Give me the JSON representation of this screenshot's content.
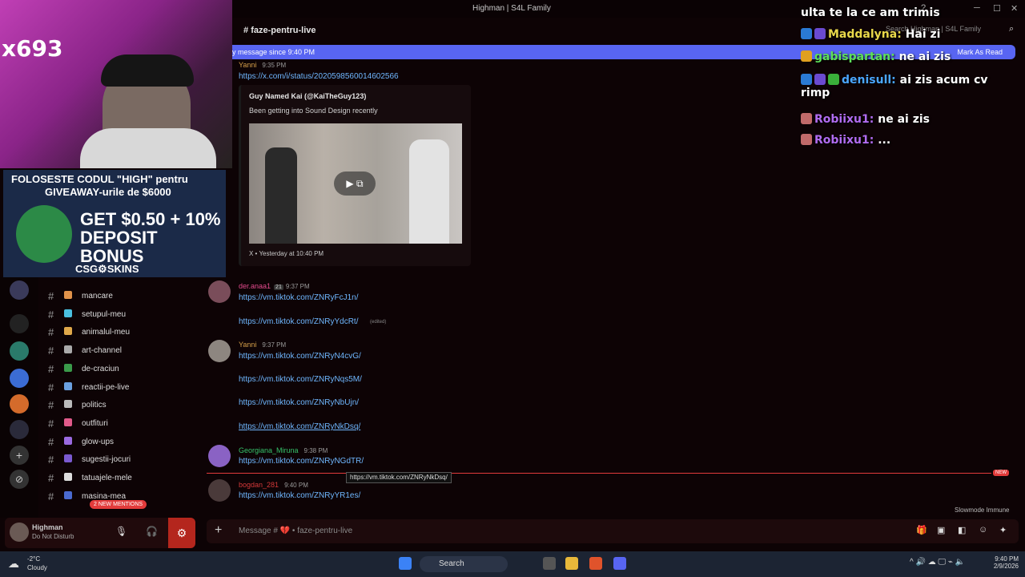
{
  "window": {
    "title": "Highman | S4L Family"
  },
  "channel": {
    "name": "faze-pentru-live",
    "search_placeholder": "Search Highman | S4L Family"
  },
  "banner": {
    "text": "y message since 9:40 PM",
    "mark_read": "Mark As Read"
  },
  "messages": [
    {
      "author": "Yanni",
      "time": "9:35 PM",
      "lines": [
        "https://x.com/i/status/2020598560014602566"
      ]
    },
    {
      "author": "der.anaa1",
      "badge": "21",
      "time": "9:37 PM",
      "lines": [
        "https://vm.tiktok.com/ZNRyFcJ1n/",
        "https://vm.tiktok.com/ZNRyYdcRt/"
      ],
      "edited": "(edited)"
    },
    {
      "author": "Yanni",
      "time": "9:37 PM",
      "lines": [
        "https://vm.tiktok.com/ZNRyN4cvG/",
        "https://vm.tiktok.com/ZNRyNqs5M/",
        "https://vm.tiktok.com/ZNRyNbUjn/",
        "https://vm.tiktok.com/ZNRyNkDsq/"
      ]
    },
    {
      "author": "Georgiana_Miruna",
      "time": "9:38 PM",
      "lines": [
        "https://vm.tiktok.com/ZNRyNGdTR/"
      ]
    },
    {
      "author": "bogdan_281",
      "time": "9:40 PM",
      "lines": [
        "https://vm.tiktok.com/ZNRyYR1es/"
      ]
    }
  ],
  "embed": {
    "author": "Guy Named Kai (@KaiTheGuy123)",
    "description": "Been getting into Sound Design recently",
    "footer": "X • Yesterday at 10:40 PM"
  },
  "tooltip": "https://vm.tiktok.com/ZNRyNkDsq/",
  "new_badge": "NEW",
  "slowmode": "Slowmode Immune",
  "composer": {
    "placeholder": "Message # 💔 • faze-pentru-live"
  },
  "webcam": {
    "count": "x693"
  },
  "ad": {
    "line1": "FOLOSESTE CODUL \"HIGH\" pentru",
    "line2": "GIVEAWAY-urile de $6000",
    "big1": "GET $0.50 + 10%",
    "big2": "DEPOSIT BONUS",
    "brand": "CSG⚙SKINS"
  },
  "channels": [
    "mancare",
    "setupul-meu",
    "animalul-meu",
    "art-channel",
    "de-craciun",
    "reactii-pe-live",
    "politics",
    "outfituri",
    "glow-ups",
    "sugestii-jocuri",
    "tatuajele-mele",
    "masina-mea"
  ],
  "mentions": "2 NEW MENTIONS",
  "user": {
    "name": "Highman",
    "status": "Do Not Disturb"
  },
  "chat_overlay": [
    {
      "user": "",
      "text": "ulta te la ce am trimis",
      "color": "#ffffff"
    },
    {
      "user": "Maddalyna:",
      "text": "Hai zi",
      "color": "#e8d84a"
    },
    {
      "user": "gabispartan:",
      "text": "ne ai zis",
      "color": "#5ee05a"
    },
    {
      "user": "denisull:",
      "text": "ai zis acum cv rimp",
      "color": "#4aa6ff"
    },
    {
      "user": "Robiixu1:",
      "text": "ne ai zis",
      "color": "#b06cf0"
    },
    {
      "user": "Robiixu1:",
      "text": "...",
      "color": "#b06cf0"
    }
  ],
  "taskbar": {
    "weather_temp": "-2°C",
    "weather_desc": "Cloudy",
    "search": "Search",
    "time": "9:40 PM",
    "date": "2/9/2026"
  },
  "colors": {
    "accent": "#5865f2",
    "link": "#6fb7ff",
    "alert": "#e23b3b"
  }
}
